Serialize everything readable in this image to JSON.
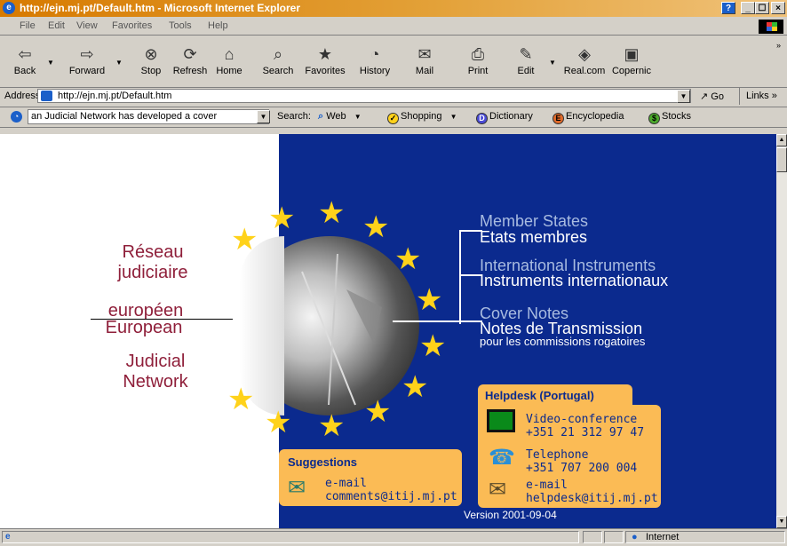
{
  "window": {
    "title": "http://ejn.mj.pt/Default.htm - Microsoft Internet Explorer",
    "controls": [
      "_",
      "☐",
      "×"
    ]
  },
  "menu": [
    "File",
    "Edit",
    "View",
    "Favorites",
    "Tools",
    "Help"
  ],
  "toolbar": {
    "buttons": [
      {
        "label": "Back",
        "icon": "back-arrow"
      },
      {
        "label": "Forward",
        "icon": "forward-arrow"
      },
      {
        "label": "Stop",
        "icon": "stop"
      },
      {
        "label": "Refresh",
        "icon": "refresh"
      },
      {
        "label": "Home",
        "icon": "home"
      },
      {
        "label": "Search",
        "icon": "search"
      },
      {
        "label": "Favorites",
        "icon": "favorites"
      },
      {
        "label": "History",
        "icon": "history"
      },
      {
        "label": "Mail",
        "icon": "mail"
      },
      {
        "label": "Print",
        "icon": "print"
      },
      {
        "label": "Edit",
        "icon": "edit"
      },
      {
        "label": "Real.com",
        "icon": "realcom"
      },
      {
        "label": "Copernic",
        "icon": "copernic"
      }
    ]
  },
  "address": {
    "label": "Address",
    "url": "http://ejn.mj.pt/Default.htm",
    "go": "Go",
    "links": "Links"
  },
  "searchbar": {
    "query": "an Judicial Network has developed a cover",
    "search_label": "Search:",
    "web": "Web",
    "shopping": "Shopping",
    "dictionary": "Dictionary",
    "encyclopedia": "Encyclopedia",
    "stocks": "Stocks"
  },
  "page": {
    "fr_name_1": "Réseau",
    "fr_name_2": "judiciaire",
    "fr_name_3": "européen",
    "en_name_1": "European",
    "en_name_2": "Judicial",
    "en_name_3": "Network",
    "nav": {
      "member_states_en": "Member States",
      "member_states_fr": "Etats membres",
      "instruments_en": "International Instruments",
      "instruments_fr": "Instruments internationaux",
      "cover_en": "Cover Notes",
      "cover_fr": "Notes de Transmission",
      "cover_fr_sub": "pour les commissions rogatoires"
    },
    "suggestions": {
      "title": "Suggestions",
      "line1": "e-mail",
      "line2": "comments@itij.mj.pt"
    },
    "helpdesk": {
      "title": "Helpdesk (Portugal)",
      "video_label": "Video-conference",
      "video_number": "+351 21 312 97 47",
      "phone_label": "Telephone",
      "phone_number": "+351 707 200 004",
      "email_label": "e-mail",
      "email_address": "helpdesk@itij.mj.pt"
    },
    "version": "Version 2001-09-04"
  },
  "status": {
    "zone": "Internet"
  },
  "colors": {
    "panel_blue": "#0b2a8e",
    "title_red": "#8f1f3a",
    "box_orange": "#fbbb55",
    "star_yellow": "#ffd21a"
  }
}
